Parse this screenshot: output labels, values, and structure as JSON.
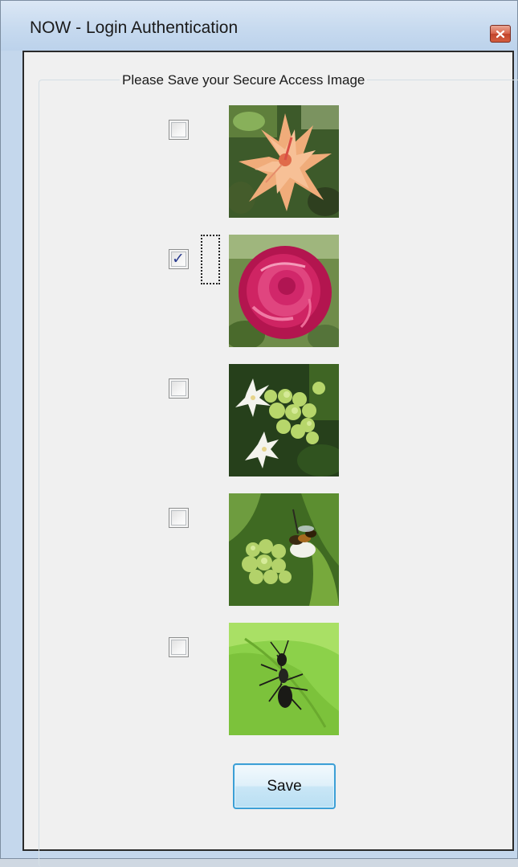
{
  "window": {
    "title": "NOW - Login Authentication",
    "close_icon": "close-icon"
  },
  "group": {
    "legend": "Please Save your Secure Access Image"
  },
  "options": [
    {
      "name": "orange-hibiscus",
      "checked": false
    },
    {
      "name": "pink-rose",
      "checked": true
    },
    {
      "name": "white-green-flower-buds",
      "checked": false
    },
    {
      "name": "bee-on-flower-buds",
      "checked": false
    },
    {
      "name": "ant-on-leaf",
      "checked": false
    }
  ],
  "actions": {
    "save_label": "Save"
  },
  "colors": {
    "titlebar": "#c7daef",
    "client_bg": "#f0f0f0",
    "close_button": "#c2442b",
    "save_border": "#3c9fd6",
    "checkmark": "#2a3b8f"
  }
}
